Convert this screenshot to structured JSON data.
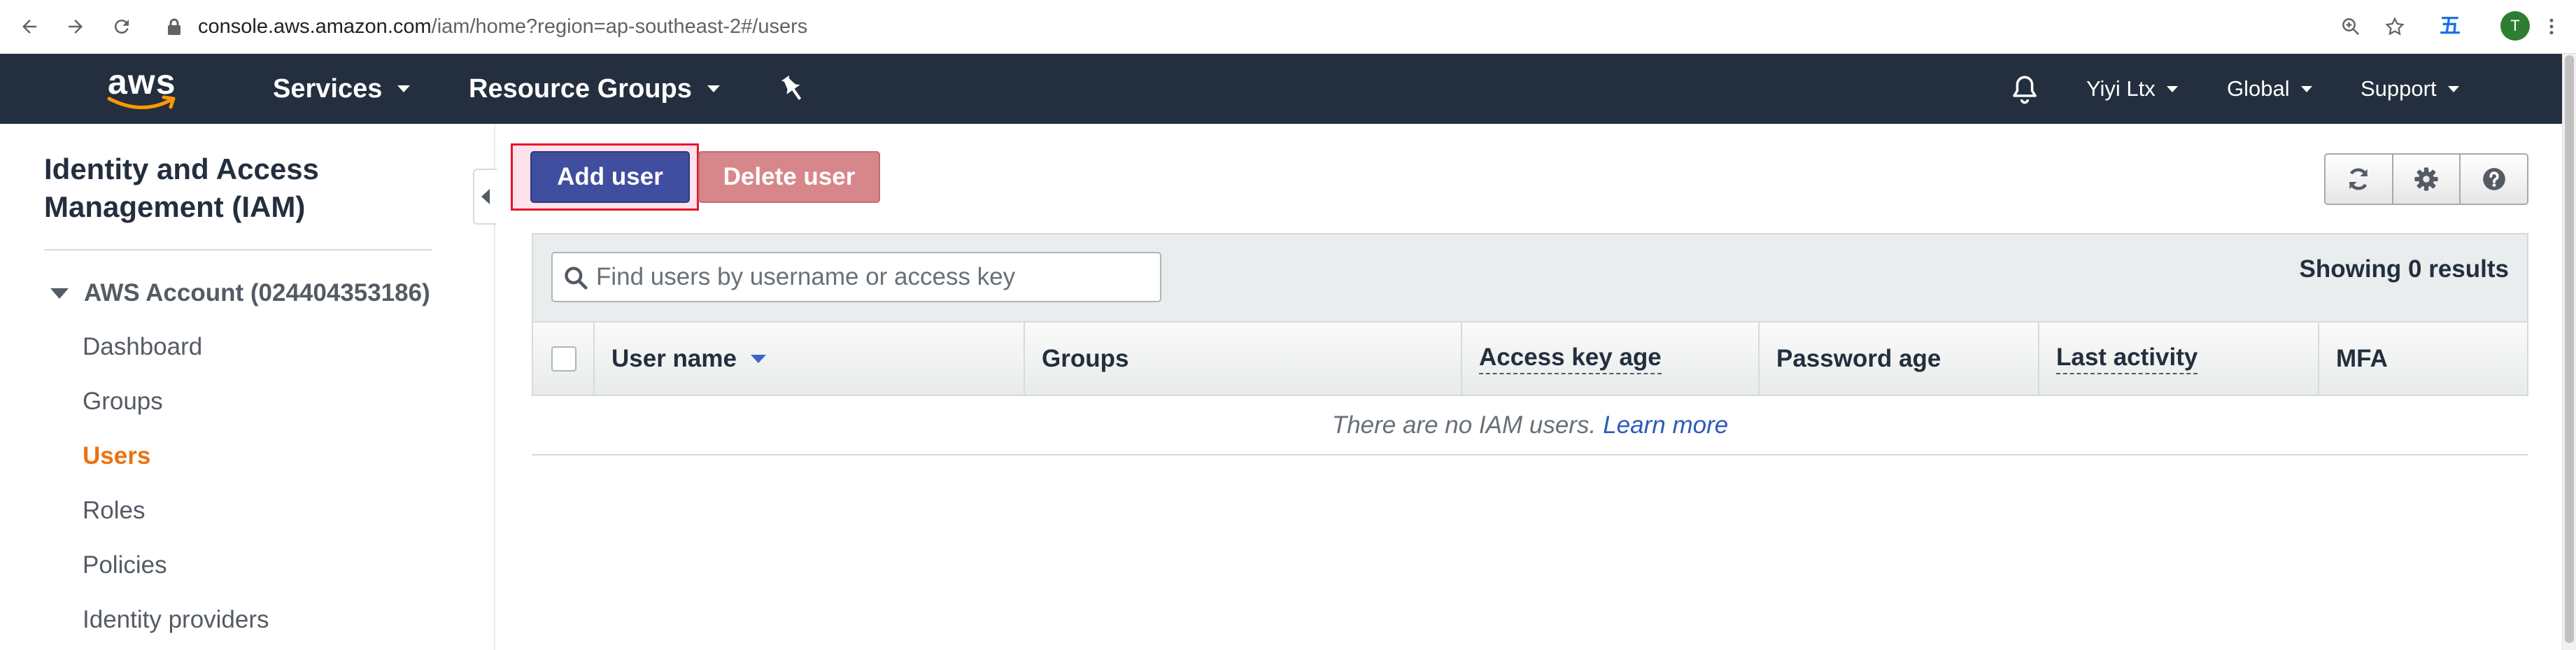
{
  "browser": {
    "url_host": "console.aws.amazon.com",
    "url_path": "/iam/home?region=ap-southeast-2#/users",
    "profile_initial": "T",
    "extension_glyph": "五"
  },
  "awsnav": {
    "logo": "aws",
    "services": "Services",
    "resource_groups": "Resource Groups",
    "user": "Yiyi Ltx",
    "region": "Global",
    "support": "Support"
  },
  "sidebar": {
    "title": "Identity and Access Management (IAM)",
    "account": "AWS Account (024404353186)",
    "items": [
      {
        "label": "Dashboard"
      },
      {
        "label": "Groups"
      },
      {
        "label": "Users",
        "active": true
      },
      {
        "label": "Roles"
      },
      {
        "label": "Policies"
      },
      {
        "label": "Identity providers"
      }
    ]
  },
  "main": {
    "add_user": "Add user",
    "delete_user": "Delete user",
    "search_placeholder": "Find users by username or access key",
    "results": "Showing 0 results",
    "columns": [
      "User name",
      "Groups",
      "Access key age",
      "Password age",
      "Last activity",
      "MFA"
    ],
    "empty_message": "There are no IAM users.",
    "learn_more": "Learn more"
  },
  "colors": {
    "nav_bg": "#232f3e",
    "primary_button": "#3f4e9e",
    "delete_button": "#d7878a",
    "active_link": "#ec7211",
    "highlight_border": "#e8142b"
  },
  "icons": [
    "back-icon",
    "forward-icon",
    "reload-icon",
    "lock-icon",
    "zoom-icon",
    "star-icon",
    "menu-icon",
    "pin-icon",
    "bell-icon",
    "refresh-icon",
    "gear-icon",
    "help-icon",
    "search-icon"
  ]
}
